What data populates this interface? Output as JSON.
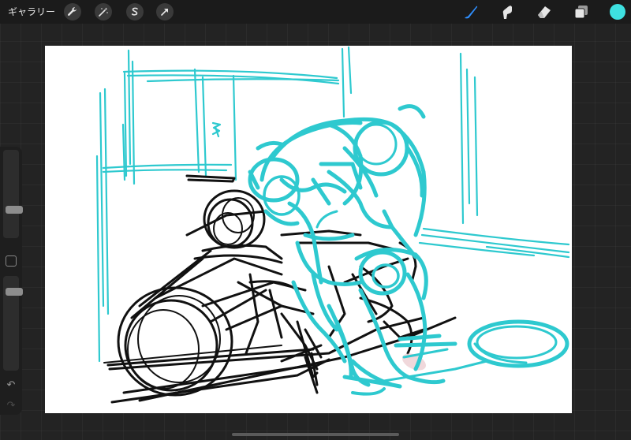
{
  "topbar": {
    "gallery_label": "ギャラリー",
    "left_tools": [
      "wrench-icon",
      "magic-wand-icon",
      "selection-icon",
      "transform-arrow-icon"
    ],
    "right_tools": [
      "brush-icon",
      "smudge-icon",
      "eraser-icon",
      "layers-icon"
    ],
    "active_tool": "brush-icon",
    "active_color": "#3ee0e0"
  },
  "sidebar": {
    "brush_size_level": 0.32,
    "opacity_level": 0.12,
    "undo_icon": "↶",
    "redo_icon": "↷"
  },
  "canvas": {
    "subject": "sketch-motorcycle-rider",
    "ink_colors": {
      "cyan": "#2ec9cf",
      "black": "#111111",
      "pink": "#e9c8cc"
    }
  }
}
